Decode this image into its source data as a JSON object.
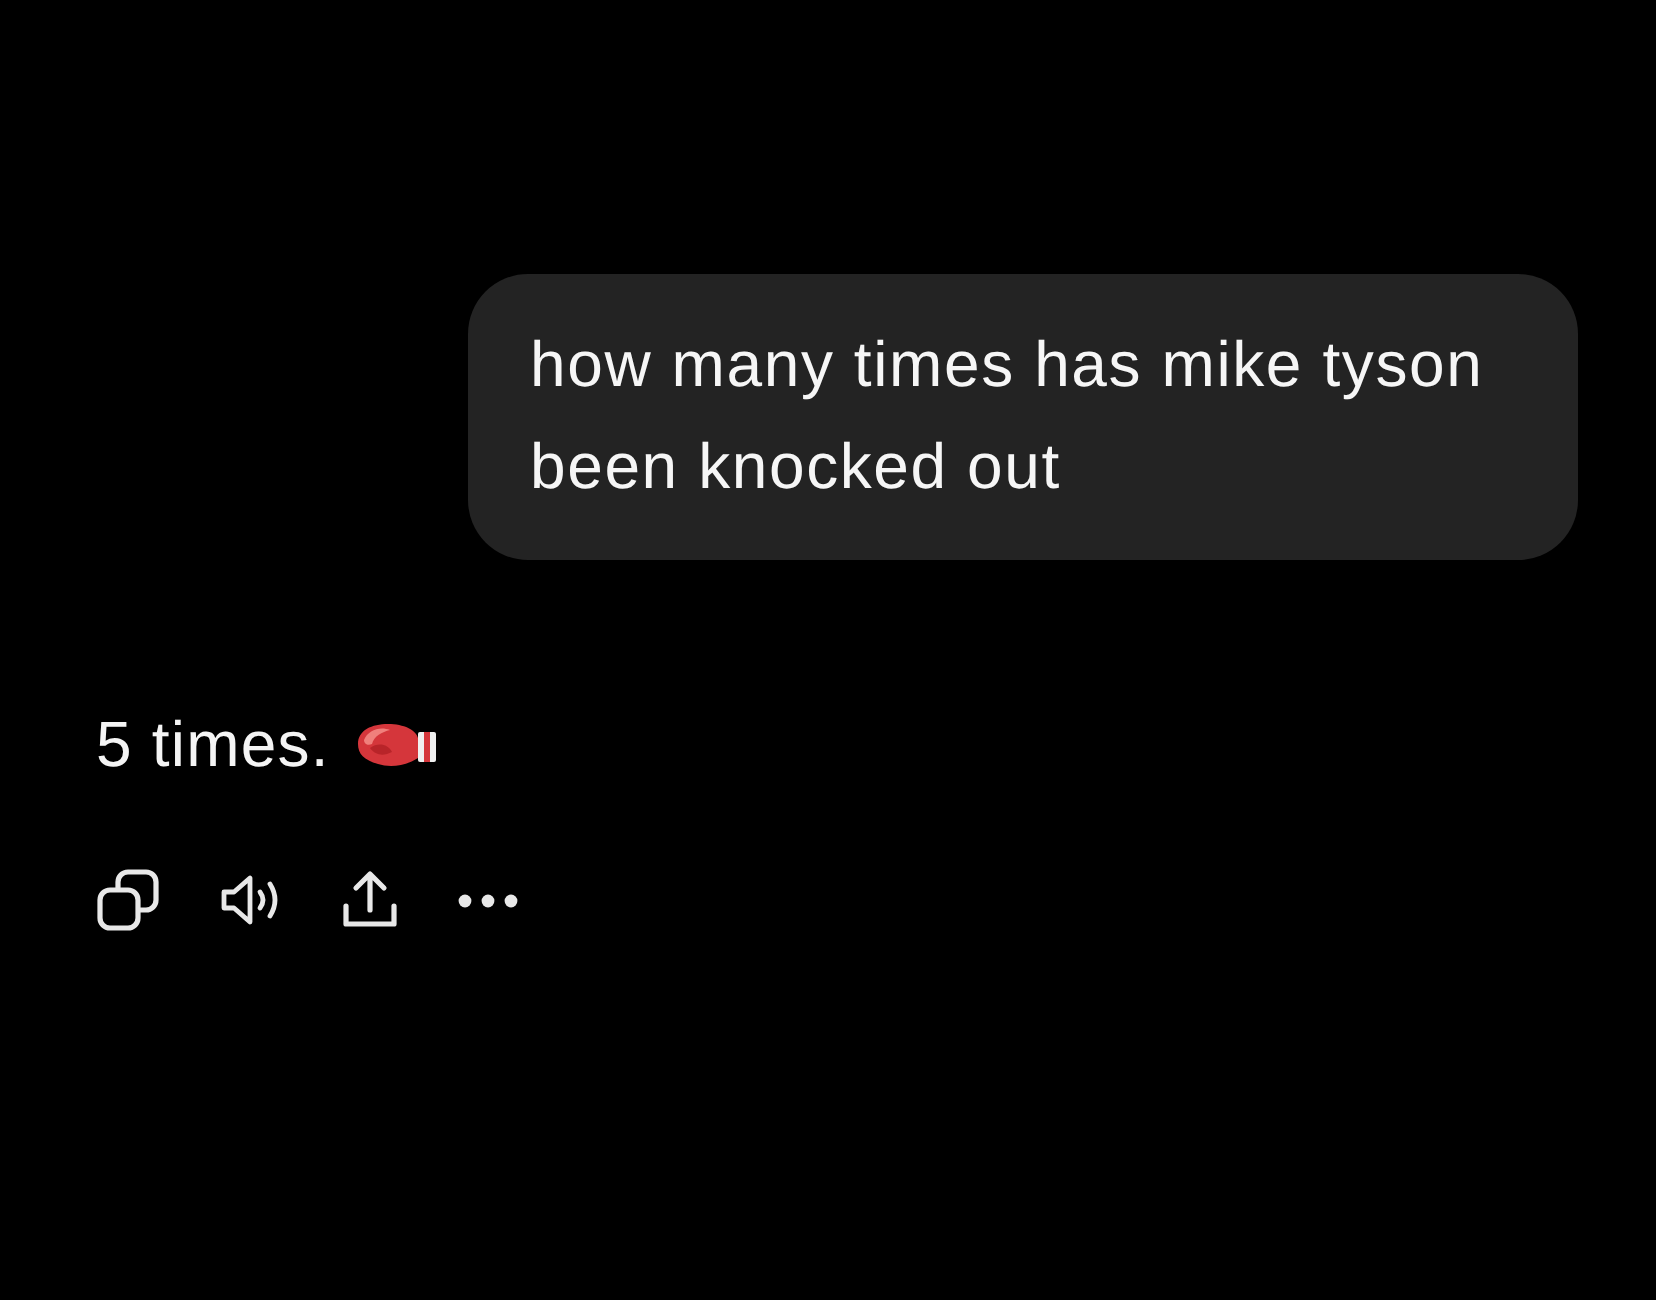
{
  "messages": [
    {
      "kind": "prompt",
      "text": "how many times has mike tyson been knocked out"
    },
    {
      "kind": "reply",
      "text": "5 times."
    }
  ]
}
